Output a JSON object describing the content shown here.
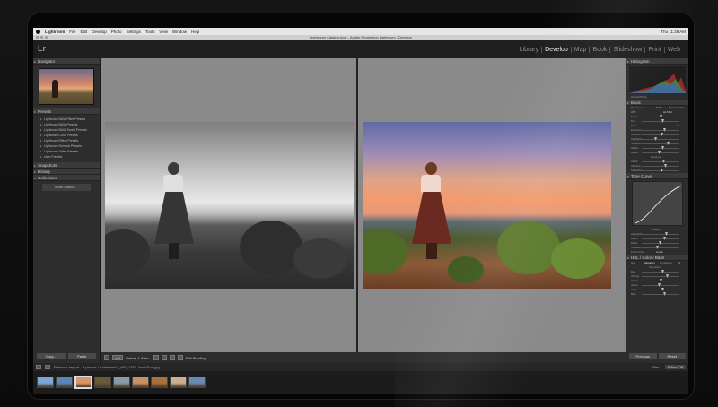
{
  "menubar": {
    "app": "Lightroom",
    "items": [
      "File",
      "Edit",
      "Develop",
      "Photo",
      "Settings",
      "Tools",
      "View",
      "Window",
      "Help"
    ],
    "clock": "Thu 11:28 AM"
  },
  "window_title": "Lightroom Catalog.lrcat - Adobe Photoshop Lightroom - Develop",
  "logo": "Lr",
  "modules": [
    "Library",
    "Develop",
    "Map",
    "Book",
    "Slideshow",
    "Print",
    "Web"
  ],
  "active_module": "Develop",
  "left_panel": {
    "navigator": "Navigator",
    "presets": "Presets",
    "preset_items": [
      "Lightroom B&W Filter Presets",
      "Lightroom B&W Presets",
      "Lightroom B&W Toned Presets",
      "Lightroom Color Presets",
      "Lightroom Effect Presets",
      "Lightroom General Presets",
      "Lightroom Video Presets",
      "User Presets"
    ],
    "snapshots": "Snapshots",
    "history": "History",
    "collections": "Collections",
    "smart_collections": "Smart Collecti...",
    "copy_button": "Copy...",
    "paste_button": "Paste"
  },
  "toolbar": {
    "view_mode": "Y|Y",
    "before_after": "Before & After :",
    "soft_proofing": "Soft Proofing"
  },
  "right_panel": {
    "histogram": "Histogram",
    "original_photo": "Original Photo",
    "basic": "Basic",
    "treatment": "Treatment :",
    "color": "Color",
    "bw": "Black & White",
    "wb": "WB :",
    "as_shot": "As Shot",
    "tone": "Tone",
    "auto": "Auto",
    "basic_sliders": [
      "Temp",
      "Tint",
      "Exposure",
      "Contrast",
      "Highlights",
      "Shadows",
      "Whites",
      "Blacks"
    ],
    "presence": "Presence",
    "presence_sliders": [
      "Clarity",
      "Vibrance",
      "Saturation"
    ],
    "tone_curve": "Tone Curve",
    "region": "Region",
    "curve_sliders": [
      "Highlights",
      "Lights",
      "Darks",
      "Shadows"
    ],
    "point_curve": "Point Curve :",
    "linear": "Linear",
    "hsl": "HSL / Color / B&W",
    "hsl_tabs": [
      "Hue",
      "Saturation",
      "Luminance",
      "All"
    ],
    "saturation": "Saturation",
    "hsl_sliders": [
      "Red",
      "Orange",
      "Yellow",
      "Green",
      "Aqua",
      "Blue"
    ],
    "previous_button": "Previous",
    "reset_button": "Reset"
  },
  "filmstrip_bar": {
    "source": "Previous Import",
    "count": "9 photos / 1 selected / _MG_1763-Janel Fort.jpg",
    "filter_label": "Filter :",
    "filter_value": "Filters Off"
  },
  "histogram_colors": [
    "#d33",
    "#3a3",
    "#36d"
  ],
  "thumbnail_colors": [
    "#7aa6d8",
    "#5a86b8",
    "#d9946a",
    "#6a5a3a",
    "#8a9aa8",
    "#c99060",
    "#a87040",
    "#c8b090",
    "#6a8ab0"
  ]
}
